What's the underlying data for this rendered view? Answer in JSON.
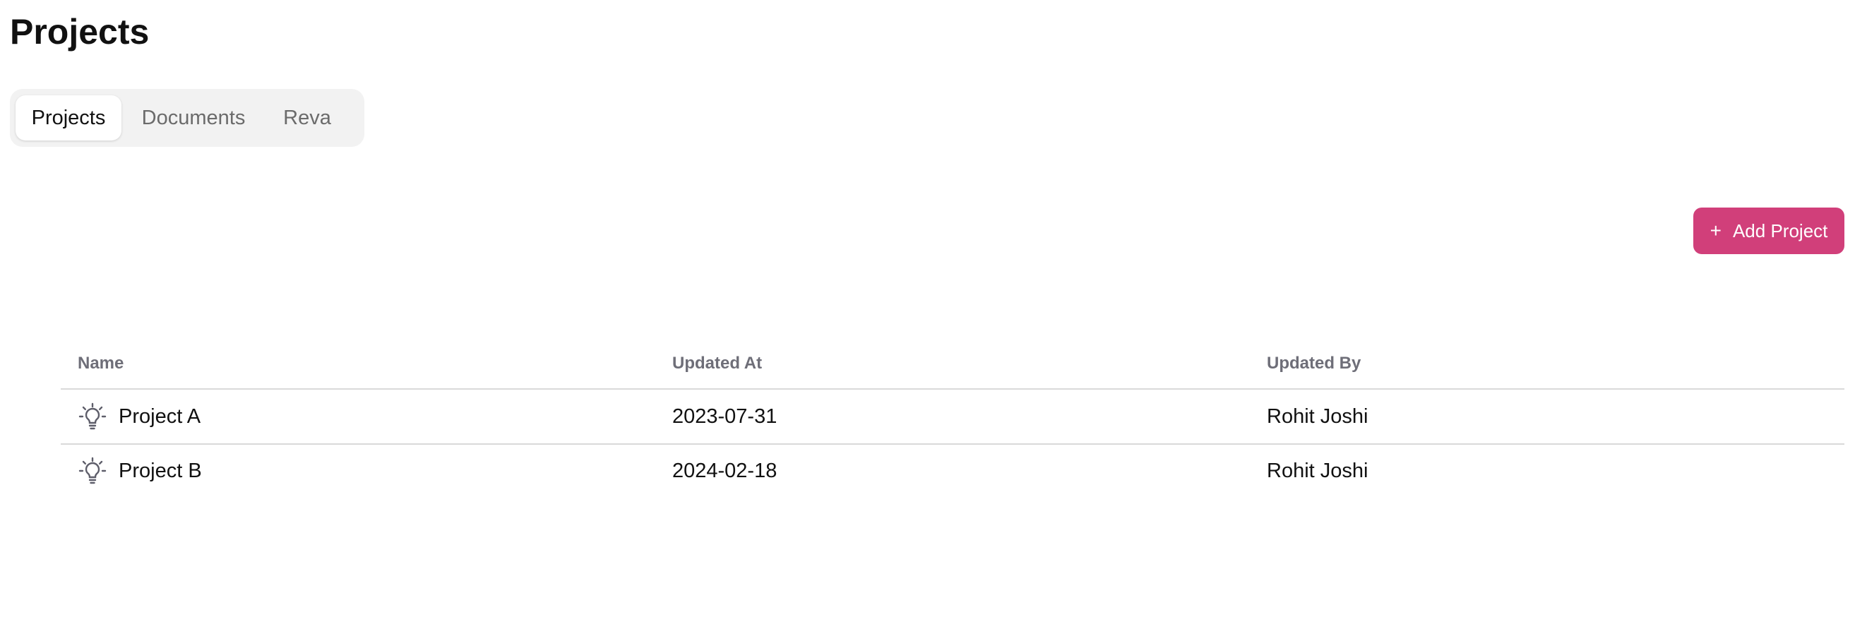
{
  "page": {
    "title": "Projects"
  },
  "tabs": [
    {
      "label": "Projects",
      "active": true
    },
    {
      "label": "Documents",
      "active": false
    },
    {
      "label": "Reva",
      "active": false
    }
  ],
  "toolbar": {
    "add_label": "Add Project",
    "add_icon": "plus-icon",
    "accent_color": "#d13f7a"
  },
  "table": {
    "columns": [
      "Name",
      "Updated At",
      "Updated By"
    ],
    "rows": [
      {
        "icon": "lightbulb-icon",
        "name": "Project A",
        "updated_at": "2023-07-31",
        "updated_by": "Rohit Joshi"
      },
      {
        "icon": "lightbulb-icon",
        "name": "Project B",
        "updated_at": "2024-02-18",
        "updated_by": "Rohit Joshi"
      }
    ]
  }
}
